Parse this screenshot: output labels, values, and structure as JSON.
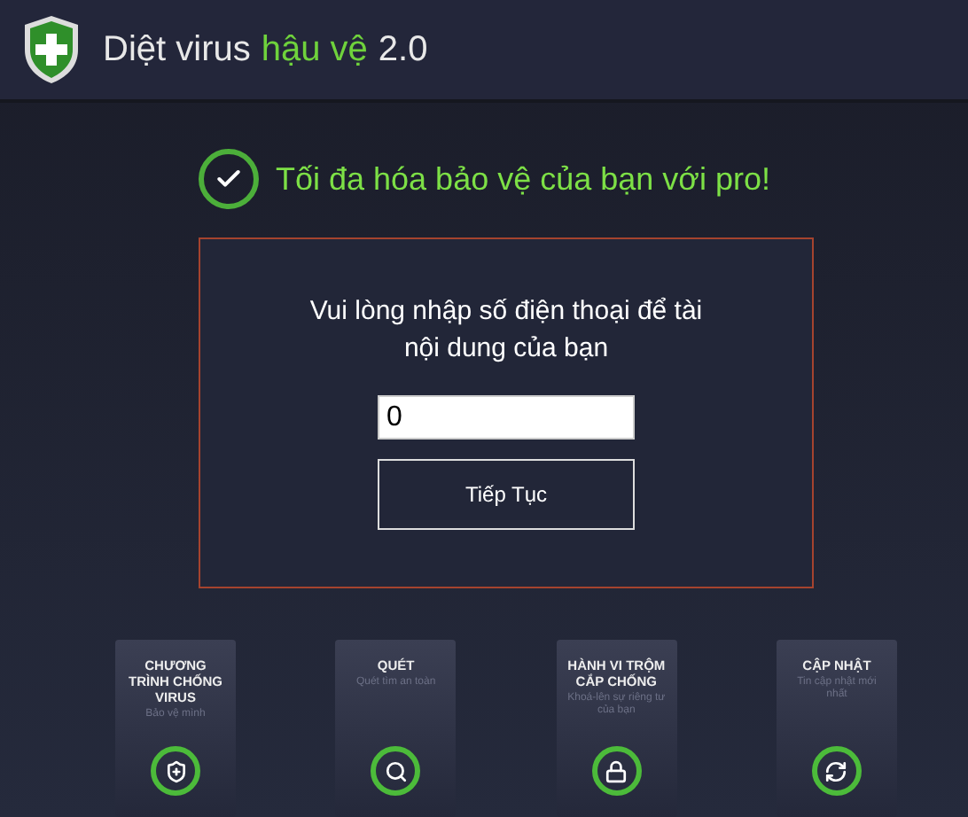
{
  "app_title": [
    {
      "text": "Diệt virus",
      "highlight": false
    },
    {
      "text": "hậu vệ",
      "highlight": true
    },
    {
      "text": "2.0",
      "highlight": false
    }
  ],
  "headline": "Tối đa hóa bảo vệ của bạn với pro!",
  "form": {
    "prompt": "Vui lòng nhập số điện thoại để tài nội dung của bạn",
    "phone_value": "0",
    "button": "Tiếp Tục"
  },
  "cards": [
    {
      "title": "CHƯƠNG TRÌNH CHỐNG VIRUS",
      "subtitle": "Bảo vệ mình"
    },
    {
      "title": "QUÉT",
      "subtitle": "Quét tìm an toàn"
    },
    {
      "title": "HÀNH VI TRỘM CẮP CHỐNG",
      "subtitle": "Khoá-lên sự riêng tư của bạn"
    },
    {
      "title": "CẬP NHẬT",
      "subtitle": "Tin cập nhật mới nhất"
    }
  ]
}
